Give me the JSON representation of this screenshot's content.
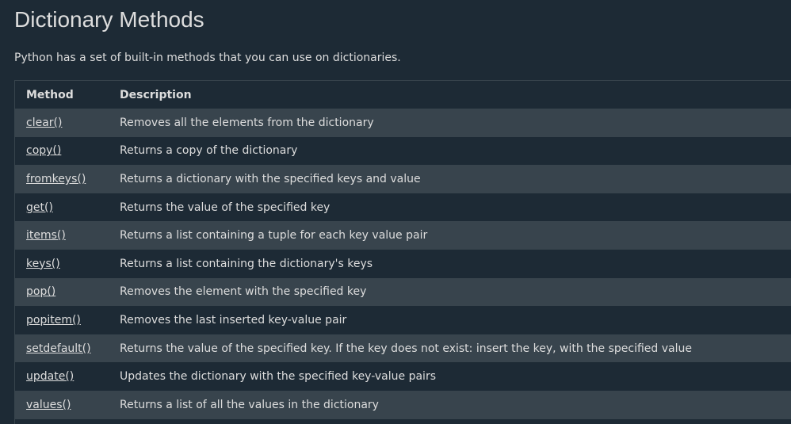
{
  "page": {
    "title": "Dictionary Methods",
    "intro": "Python has a set of built-in methods that you can use on dictionaries."
  },
  "table": {
    "headers": [
      "Method",
      "Description"
    ],
    "rows": [
      {
        "method": "clear()",
        "description": "Removes all the elements from the dictionary"
      },
      {
        "method": "copy()",
        "description": "Returns a copy of the dictionary"
      },
      {
        "method": "fromkeys()",
        "description": "Returns a dictionary with the specified keys and value"
      },
      {
        "method": "get()",
        "description": "Returns the value of the specified key"
      },
      {
        "method": "items()",
        "description": "Returns a list containing a tuple for each key value pair"
      },
      {
        "method": "keys()",
        "description": "Returns a list containing the dictionary's keys"
      },
      {
        "method": "pop()",
        "description": "Removes the element with the specified key"
      },
      {
        "method": "popitem()",
        "description": "Removes the last inserted key-value pair"
      },
      {
        "method": "setdefault()",
        "description": "Returns the value of the specified key. If the key does not exist: insert the key, with the specified value"
      },
      {
        "method": "update()",
        "description": "Updates the dictionary with the specified key-value pairs"
      },
      {
        "method": "values()",
        "description": "Returns a list of all the values in the dictionary"
      }
    ]
  },
  "colors": {
    "background": "#1d2a35",
    "row_alt": "#38444d",
    "text": "#dddddd"
  }
}
